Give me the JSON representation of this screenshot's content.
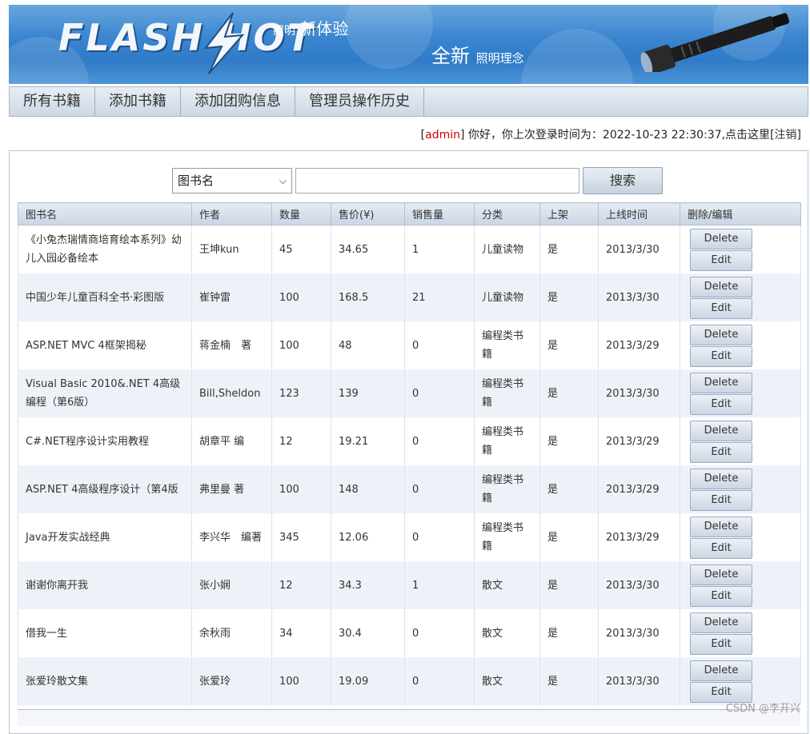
{
  "banner": {
    "brand": "FLASH  HOT",
    "slogan_small": "照明",
    "slogan_big": "新体验",
    "slogan2_big": "全新",
    "slogan2_small": "照明理念"
  },
  "nav": [
    {
      "label": "所有书籍"
    },
    {
      "label": "添加书籍"
    },
    {
      "label": "添加团购信息"
    },
    {
      "label": "管理员操作历史"
    }
  ],
  "welcome": {
    "user": "admin",
    "message": " 你好，你上次登录时间为：2022-10-23 22:30:37,点击这里",
    "logout": "注销"
  },
  "search": {
    "field": "图书名",
    "button": "搜索"
  },
  "table": {
    "headers": [
      "图书名",
      "作者",
      "数量",
      "售价(¥)",
      "销售量",
      "分类",
      "上架",
      "上线时间",
      "删除/编辑"
    ],
    "delete_label": "Delete",
    "edit_label": "Edit",
    "rows": [
      {
        "name": "《小兔杰瑞情商培育绘本系列》幼儿入园必备绘本",
        "author": "王坤kun",
        "qty": "45",
        "price": "34.65",
        "sales": "1",
        "cat": "儿童读物",
        "shelf": "是",
        "date": "2013/3/30"
      },
      {
        "name": "中国少年儿童百科全书·彩图版",
        "author": "崔钟雷",
        "qty": "100",
        "price": "168.5",
        "sales": "21",
        "cat": "儿童读物",
        "shelf": "是",
        "date": "2013/3/30"
      },
      {
        "name": "ASP.NET MVC 4框架揭秘",
        "author": "蒋金楠　著",
        "qty": "100",
        "price": "48",
        "sales": "0",
        "cat": "编程类书籍",
        "shelf": "是",
        "date": "2013/3/29"
      },
      {
        "name": "Visual Basic 2010&.NET 4高级编程（第6版）",
        "author": "Bill,Sheldon",
        "qty": "123",
        "price": "139",
        "sales": "0",
        "cat": "编程类书籍",
        "shelf": "是",
        "date": "2013/3/30"
      },
      {
        "name": "C#.NET程序设计实用教程",
        "author": "胡章平 编",
        "qty": "12",
        "price": "19.21",
        "sales": "0",
        "cat": "编程类书籍",
        "shelf": "是",
        "date": "2013/3/29"
      },
      {
        "name": "ASP.NET 4高级程序设计（第4版",
        "author": "弗里曼 著",
        "qty": "100",
        "price": "148",
        "sales": "0",
        "cat": "编程类书籍",
        "shelf": "是",
        "date": "2013/3/29"
      },
      {
        "name": "Java开发实战经典",
        "author": "李兴华　编著",
        "qty": "345",
        "price": "12.06",
        "sales": "0",
        "cat": "编程类书籍",
        "shelf": "是",
        "date": "2013/3/29"
      },
      {
        "name": "谢谢你离开我",
        "author": "张小娴",
        "qty": "12",
        "price": "34.3",
        "sales": "1",
        "cat": "散文",
        "shelf": "是",
        "date": "2013/3/30"
      },
      {
        "name": "借我一生",
        "author": "余秋雨",
        "qty": "34",
        "price": "30.4",
        "sales": "0",
        "cat": "散文",
        "shelf": "是",
        "date": "2013/3/30"
      },
      {
        "name": "张爱玲散文集",
        "author": "张爱玲",
        "qty": "100",
        "price": "19.09",
        "sales": "0",
        "cat": "散文",
        "shelf": "是",
        "date": "2013/3/30"
      }
    ]
  },
  "watermark": "CSDN @李开兴",
  "colors": {
    "accent": "#3b86d0",
    "user": "#d00000"
  }
}
